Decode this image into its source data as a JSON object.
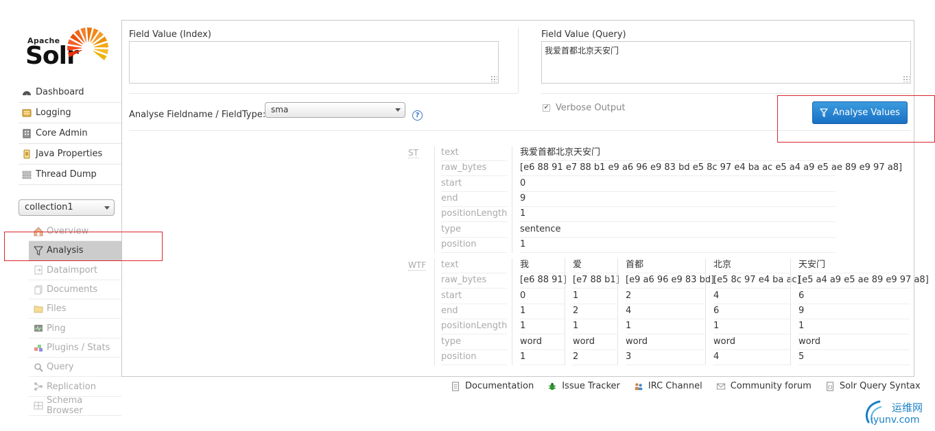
{
  "logo": {
    "apache": "Apache",
    "solr": "Solr"
  },
  "main_nav": [
    {
      "label": "Dashboard",
      "icon": "dashboard-icon"
    },
    {
      "label": "Logging",
      "icon": "logging-icon"
    },
    {
      "label": "Core Admin",
      "icon": "core-admin-icon"
    },
    {
      "label": "Java Properties",
      "icon": "java-properties-icon"
    },
    {
      "label": "Thread Dump",
      "icon": "thread-dump-icon"
    }
  ],
  "core_selector": {
    "value": "collection1"
  },
  "core_menu": [
    {
      "label": "Overview",
      "icon": "home-icon",
      "active": false
    },
    {
      "label": "Analysis",
      "icon": "filter-icon",
      "active": true
    },
    {
      "label": "Dataimport",
      "icon": "dataimport-icon",
      "active": false
    },
    {
      "label": "Documents",
      "icon": "documents-icon",
      "active": false
    },
    {
      "label": "Files",
      "icon": "files-icon",
      "active": false
    },
    {
      "label": "Ping",
      "icon": "ping-icon",
      "active": false
    },
    {
      "label": "Plugins / Stats",
      "icon": "plugins-icon",
      "active": false
    },
    {
      "label": "Query",
      "icon": "query-icon",
      "active": false
    },
    {
      "label": "Replication",
      "icon": "replication-icon",
      "active": false
    },
    {
      "label": "Schema Browser",
      "icon": "schema-browser-icon",
      "active": false
    }
  ],
  "analysis": {
    "index_label": "Field Value (Index)",
    "index_value": "",
    "query_label": "Field Value (Query)",
    "query_value": "我爱首都北京天安门",
    "fieldtype_label": "Analyse Fieldname / FieldType:",
    "fieldtype_value": "sma",
    "verbose_label": "Verbose Output",
    "verbose_checked": true,
    "button_label": "Analyse Values",
    "row_names": [
      "text",
      "raw_bytes",
      "start",
      "end",
      "positionLength",
      "type",
      "position"
    ],
    "stages": [
      {
        "name": "ST",
        "tokens": [
          [
            "我爱首都北京天安门",
            "[e6 88 91 e7 88 b1 e9 a6 96 e9 83 bd e5 8c 97 e4 ba ac e5 a4 a9 e5 ae 89 e9 97 a8]",
            "0",
            "9",
            "1",
            "sentence",
            "1"
          ]
        ]
      },
      {
        "name": "WTF",
        "tokens": [
          [
            "我",
            "[e6 88 91]",
            "0",
            "1",
            "1",
            "word",
            "1"
          ],
          [
            "爱",
            "[e7 88 b1]",
            "1",
            "2",
            "1",
            "word",
            "2"
          ],
          [
            "首都",
            "[e9 a6 96 e9 83 bd]",
            "2",
            "4",
            "1",
            "word",
            "3"
          ],
          [
            "北京",
            "[e5 8c 97 e4 ba ac]",
            "4",
            "6",
            "1",
            "word",
            "4"
          ],
          [
            "天安门",
            "[e5 a4 a9 e5 ae 89 e9 97 a8]",
            "6",
            "9",
            "1",
            "word",
            "5"
          ]
        ]
      }
    ]
  },
  "footer": [
    {
      "label": "Documentation",
      "icon": "documentation-icon"
    },
    {
      "label": "Issue Tracker",
      "icon": "bug-icon"
    },
    {
      "label": "IRC Channel",
      "icon": "irc-icon"
    },
    {
      "label": "Community forum",
      "icon": "mail-icon"
    },
    {
      "label": "Solr Query Syntax",
      "icon": "query-syntax-icon"
    }
  ],
  "watermark": {
    "cn": "运维网",
    "url": "iyunv.com"
  },
  "colors": {
    "accent": "#1a70c4",
    "highlight": "#d9252b",
    "muted": "#aaaaaa"
  }
}
